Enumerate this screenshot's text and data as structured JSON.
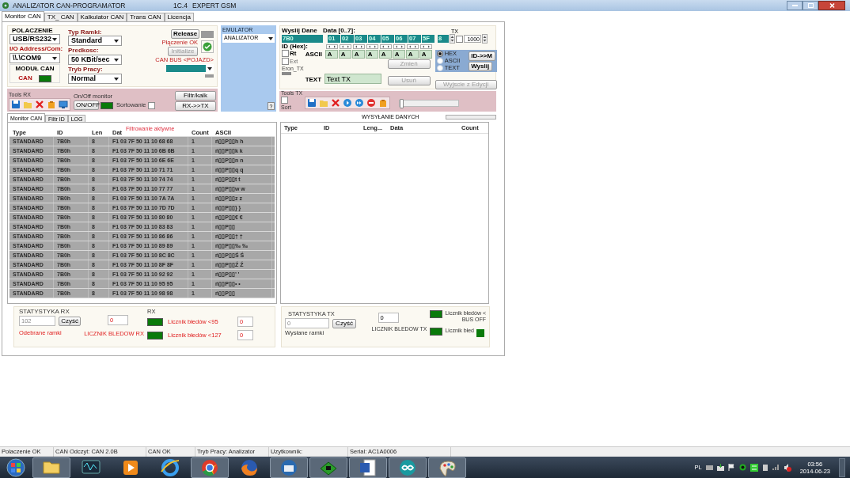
{
  "window": {
    "title": "ANALIZATOR CAN-PROGRAMATOR",
    "version": "1C.4",
    "edition": "EXPERT GSM"
  },
  "tabs": [
    {
      "label": "Monitor CAN",
      "selected": true
    },
    {
      "label": "TX_ CAN",
      "selected": false
    },
    {
      "label": "Kalkulator CAN",
      "selected": false
    },
    {
      "label": "Trans CAN",
      "selected": false
    },
    {
      "label": "Licencja",
      "selected": false
    }
  ],
  "connection": {
    "title": "POLACZENIE",
    "port": "USB/RS232",
    "address_label": "I/O Address/Com:",
    "address": "\\\\.\\COM9",
    "module_title": "MODUŁ CAN",
    "module_label": "CAN",
    "module_on": true
  },
  "frame": {
    "type_label": "Typ Ramki:",
    "type": "Standard",
    "speed_label": "Predkosc:",
    "speed": "50 KBit/sec",
    "mode_label": "Tryb Pracy:",
    "mode": "Normal"
  },
  "link": {
    "release": "Release",
    "message": "Płączenie OK",
    "connected": true,
    "initialize": "Initialize",
    "initialize_disabled": true,
    "bus_label": "CAN BUS <POJAZD>"
  },
  "emulator": {
    "title": "EMULATOR",
    "mode": "ANALIZATOR",
    "help": "?"
  },
  "tools_rx": {
    "title": "Tools RX",
    "monitor_title": "On/Off monitor",
    "toggle": "ON/OFF",
    "monitor_on": true,
    "sort_label": "Sortowanie",
    "sort_checked": false,
    "filter": "Filtr/kalk",
    "rx_to_tx": "RX->>TX"
  },
  "send": {
    "title": "Wyslij Dane",
    "data_label": "Data [0..7]:",
    "id": "7B0",
    "id_label": "ID (Hex):",
    "bytes": [
      "01",
      "02",
      "03",
      "04",
      "05",
      "06",
      "07",
      "5F"
    ],
    "length": "8",
    "tx_label": "TX",
    "tx_checked": false,
    "interval": "1000",
    "rt_label": "Rt",
    "rt_checked": false,
    "ext_label": "Ext",
    "ext_checked": false,
    "eron_label": "Eron_TX",
    "ascii_label": "ASCII",
    "ascii": [
      "A",
      "A",
      "A",
      "A",
      "A",
      "A",
      "A",
      "A"
    ],
    "text_label": "TEXT",
    "text": "Text TX",
    "change": "Zmień",
    "delete": "Usuń",
    "formats": [
      {
        "label": "HEX",
        "selected": true
      },
      {
        "label": "ASCII",
        "selected": false
      },
      {
        "label": "TEXT",
        "selected": false
      }
    ],
    "id_to_m": "ID->>M",
    "send": "Wyslij",
    "exit": "Wyjscie z Edycji"
  },
  "tools_tx": {
    "title": "Tools TX",
    "sort_label": "Sort",
    "sort_checked": false,
    "slider": {
      "level": 0
    }
  },
  "sending": {
    "label": "WYSYŁANIE DANYCH"
  },
  "subtabs": [
    {
      "label": "Monitor CAN",
      "selected": true
    },
    {
      "label": "Filtr ID",
      "selected": false
    },
    {
      "label": "LOG",
      "selected": false
    }
  ],
  "rx_table": {
    "columns": [
      "Type",
      "ID",
      "Len",
      "Dat",
      "Count",
      "ASCII"
    ],
    "filter_notice": "Filtrowanie aktywne",
    "rows": [
      [
        "STANDARD",
        "7B0h",
        "8",
        "F1 03 7F 50 11 10 68 68",
        "1",
        "ń▯▯P▯▯h h"
      ],
      [
        "STANDARD",
        "7B0h",
        "8",
        "F1 03 7F 50 11 10 6B 6B",
        "1",
        "ń▯▯P▯▯k k"
      ],
      [
        "STANDARD",
        "7B0h",
        "8",
        "F1 03 7F 50 11 10 6E 6E",
        "1",
        "ń▯▯P▯▯n n"
      ],
      [
        "STANDARD",
        "7B0h",
        "8",
        "F1 03 7F 50 11 10 71 71",
        "1",
        "ń▯▯P▯▯q q"
      ],
      [
        "STANDARD",
        "7B0h",
        "8",
        "F1 03 7F 50 11 10 74 74",
        "1",
        "ń▯▯P▯▯t t"
      ],
      [
        "STANDARD",
        "7B0h",
        "8",
        "F1 03 7F 50 11 10 77 77",
        "1",
        "ń▯▯P▯▯w w"
      ],
      [
        "STANDARD",
        "7B0h",
        "8",
        "F1 03 7F 50 11 10 7A 7A",
        "1",
        "ń▯▯P▯▯z z"
      ],
      [
        "STANDARD",
        "7B0h",
        "8",
        "F1 03 7F 50 11 10 7D 7D",
        "1",
        "ń▯▯P▯▯} }"
      ],
      [
        "STANDARD",
        "7B0h",
        "8",
        "F1 03 7F 50 11 10 80 80",
        "1",
        "ń▯▯P▯▯€ €"
      ],
      [
        "STANDARD",
        "7B0h",
        "8",
        "F1 03 7F 50 11 10 83 83",
        "1",
        "ń▯▯P▯▯"
      ],
      [
        "STANDARD",
        "7B0h",
        "8",
        "F1 03 7F 50 11 10 86 86",
        "1",
        "ń▯▯P▯▯† †"
      ],
      [
        "STANDARD",
        "7B0h",
        "8",
        "F1 03 7F 50 11 10 89 89",
        "1",
        "ń▯▯P▯▯‰ ‰"
      ],
      [
        "STANDARD",
        "7B0h",
        "8",
        "F1 03 7F 50 11 10 8C 8C",
        "1",
        "ń▯▯P▯▯Ś Ś"
      ],
      [
        "STANDARD",
        "7B0h",
        "8",
        "F1 03 7F 50 11 10 8F 8F",
        "1",
        "ń▯▯P▯▯Ź Ź"
      ],
      [
        "STANDARD",
        "7B0h",
        "8",
        "F1 03 7F 50 11 10 92 92",
        "1",
        "ń▯▯P▯▯’ ’"
      ],
      [
        "STANDARD",
        "7B0h",
        "8",
        "F1 03 7F 50 11 10 95 95",
        "1",
        "ń▯▯P▯▯• •"
      ],
      [
        "STANDARD",
        "7B0h",
        "8",
        "F1 03 7F 50 11 10 98 98",
        "1",
        "ń▯▯P▯▯"
      ]
    ]
  },
  "tx_table": {
    "columns": [
      "Type",
      "ID",
      "Leng...",
      "Data",
      "Count"
    ]
  },
  "rx_stats": {
    "title": "STATYSTYKA RX",
    "received": "102",
    "clear": "Czyść",
    "received_label": "Odebrane ramki",
    "errors": "0",
    "errors_label": "LICZNIK BLEDOW RX",
    "rx_label": "RX",
    "counters": [
      {
        "label": "Licznik błedów <95",
        "value": "0",
        "on": true
      },
      {
        "label": "Licznik błedów <127",
        "value": "0",
        "on": true
      }
    ]
  },
  "tx_stats": {
    "title": "STATYSTYKA TX",
    "sent": "0",
    "clear": "Czyść",
    "sent_label": "Wysłane ramki",
    "errors": "0",
    "errors_label": "LICZNIK BLEDOW TX",
    "indicators": [
      {
        "label": "Licznik błedów <",
        "sublabel": "BUS OFF",
        "on": true
      },
      {
        "label": "Licznik błed",
        "on": true
      }
    ]
  },
  "status_bar": [
    "Polaczenie OK",
    "CAN Odczyt: CAN 2.0B",
    "CAN OK",
    "Tryb Pracy: Analizator",
    "Uzytkownik:",
    "Serial: AC1A0006"
  ],
  "taskbar": {
    "language": "PL",
    "time": "03:56",
    "date": "2014-06-23"
  }
}
